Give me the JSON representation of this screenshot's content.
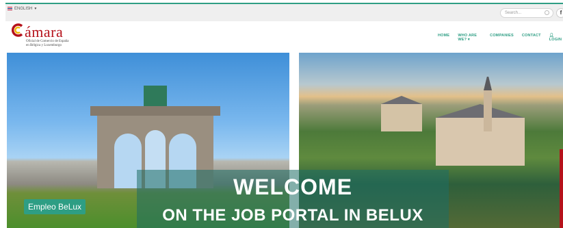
{
  "topbar": {
    "language": "ENGLISH",
    "search_placeholder": "Search...",
    "facebook": "f"
  },
  "logo": {
    "word": "ámara",
    "subtitle_line1": "Oficial de Comercio de España",
    "subtitle_line2": "en Bélgica y Luxemburgo"
  },
  "nav": {
    "home": "HOME",
    "who": "WHO ARE WE? ▾",
    "companies": "COMPANIES",
    "contact": "CONTACT",
    "login": "LOGIN"
  },
  "hero": {
    "welcome": "WELCOME",
    "subtitle": "ON THE JOB PORTAL IN BELUX",
    "badge": "Empleo BeLux"
  },
  "colors": {
    "accent": "#2e9e84",
    "brand_red": "#b5121b"
  }
}
